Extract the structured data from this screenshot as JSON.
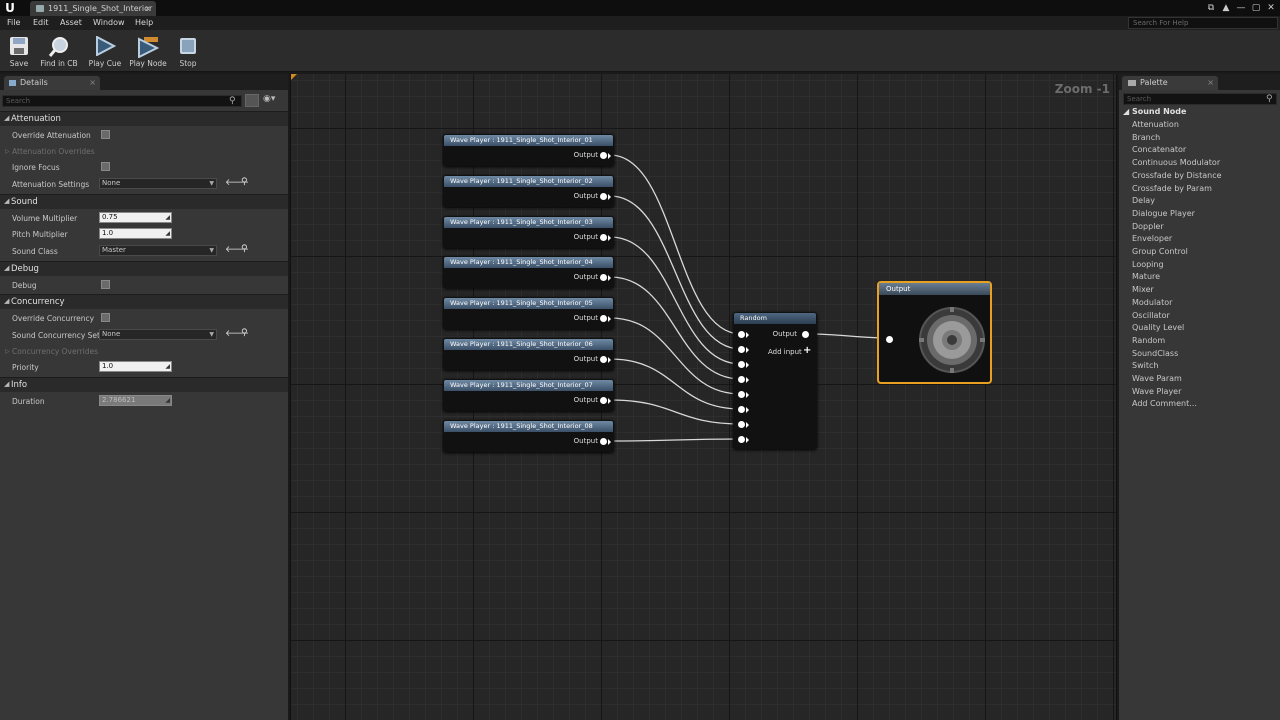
{
  "app": {
    "tab_title": "1911_Single_Shot_Interior",
    "tab_close": "×",
    "logo": "U",
    "window_controls": [
      "⧉",
      "▲",
      "—",
      "▢",
      "✕"
    ]
  },
  "menu": {
    "items": [
      "File",
      "Edit",
      "Asset",
      "Window",
      "Help"
    ],
    "help_search_placeholder": "Search For Help"
  },
  "toolbar": {
    "buttons": [
      {
        "label": "Save",
        "icon": "save-icon"
      },
      {
        "label": "Find in CB",
        "icon": "magnifier-icon"
      },
      {
        "label": "Play Cue",
        "icon": "play-icon"
      },
      {
        "label": "Play Node",
        "icon": "play-node-icon"
      },
      {
        "label": "Stop",
        "icon": "stop-icon"
      }
    ]
  },
  "details": {
    "tab_label": "Details",
    "tab_close": "×",
    "search_placeholder": "Search",
    "categories": {
      "attenuation": {
        "label": "Attenuation",
        "override_attenuation": "Override Attenuation",
        "attenuation_overrides": "Attenuation Overrides",
        "ignore_focus": "Ignore Focus",
        "attenuation_settings": "Attenuation Settings",
        "attenuation_settings_value": "None"
      },
      "sound": {
        "label": "Sound",
        "volume_multiplier": "Volume Multiplier",
        "volume_multiplier_value": "0.75",
        "pitch_multiplier": "Pitch Multiplier",
        "pitch_multiplier_value": "1.0",
        "sound_class": "Sound Class",
        "sound_class_value": "Master"
      },
      "debug": {
        "label": "Debug",
        "debug": "Debug"
      },
      "concurrency": {
        "label": "Concurrency",
        "override_concurrency": "Override Concurrency",
        "sound_concurrency_settings": "Sound Concurrency Setti",
        "sound_concurrency_value": "None",
        "concurrency_overrides": "Concurrency Overrides",
        "priority": "Priority",
        "priority_value": "1.0"
      },
      "info": {
        "label": "Info",
        "duration": "Duration",
        "duration_value": "2.786621"
      }
    }
  },
  "graph": {
    "zoom": "Zoom -1",
    "wave_players": [
      "Wave Player : 1911_Single_Shot_Interior_01",
      "Wave Player : 1911_Single_Shot_Interior_02",
      "Wave Player : 1911_Single_Shot_Interior_03",
      "Wave Player : 1911_Single_Shot_Interior_04",
      "Wave Player : 1911_Single_Shot_Interior_05",
      "Wave Player : 1911_Single_Shot_Interior_06",
      "Wave Player : 1911_Single_Shot_Interior_07",
      "Wave Player : 1911_Single_Shot_Interior_08"
    ],
    "output_pin_label": "Output",
    "random_node": {
      "title": "Random",
      "output_label": "Output",
      "add_input_label": "Add input",
      "add_input_symbol": "+"
    },
    "output_node": {
      "title": "Output"
    }
  },
  "palette": {
    "tab_label": "Palette",
    "tab_close": "×",
    "search_placeholder": "Search",
    "category": "Sound Node",
    "items": [
      "Attenuation",
      "Branch",
      "Concatenator",
      "Continuous Modulator",
      "Crossfade by Distance",
      "Crossfade by Param",
      "Delay",
      "Dialogue Player",
      "Doppler",
      "Enveloper",
      "Group Control",
      "Looping",
      "Mature",
      "Mixer",
      "Modulator",
      "Oscillator",
      "Quality Level",
      "Random",
      "SoundClass",
      "Switch",
      "Wave Param",
      "Wave Player",
      "Add Comment..."
    ]
  },
  "colors": {
    "selection_orange": "#e8a020",
    "panel_bg": "#373737",
    "graph_bg": "#262626"
  }
}
